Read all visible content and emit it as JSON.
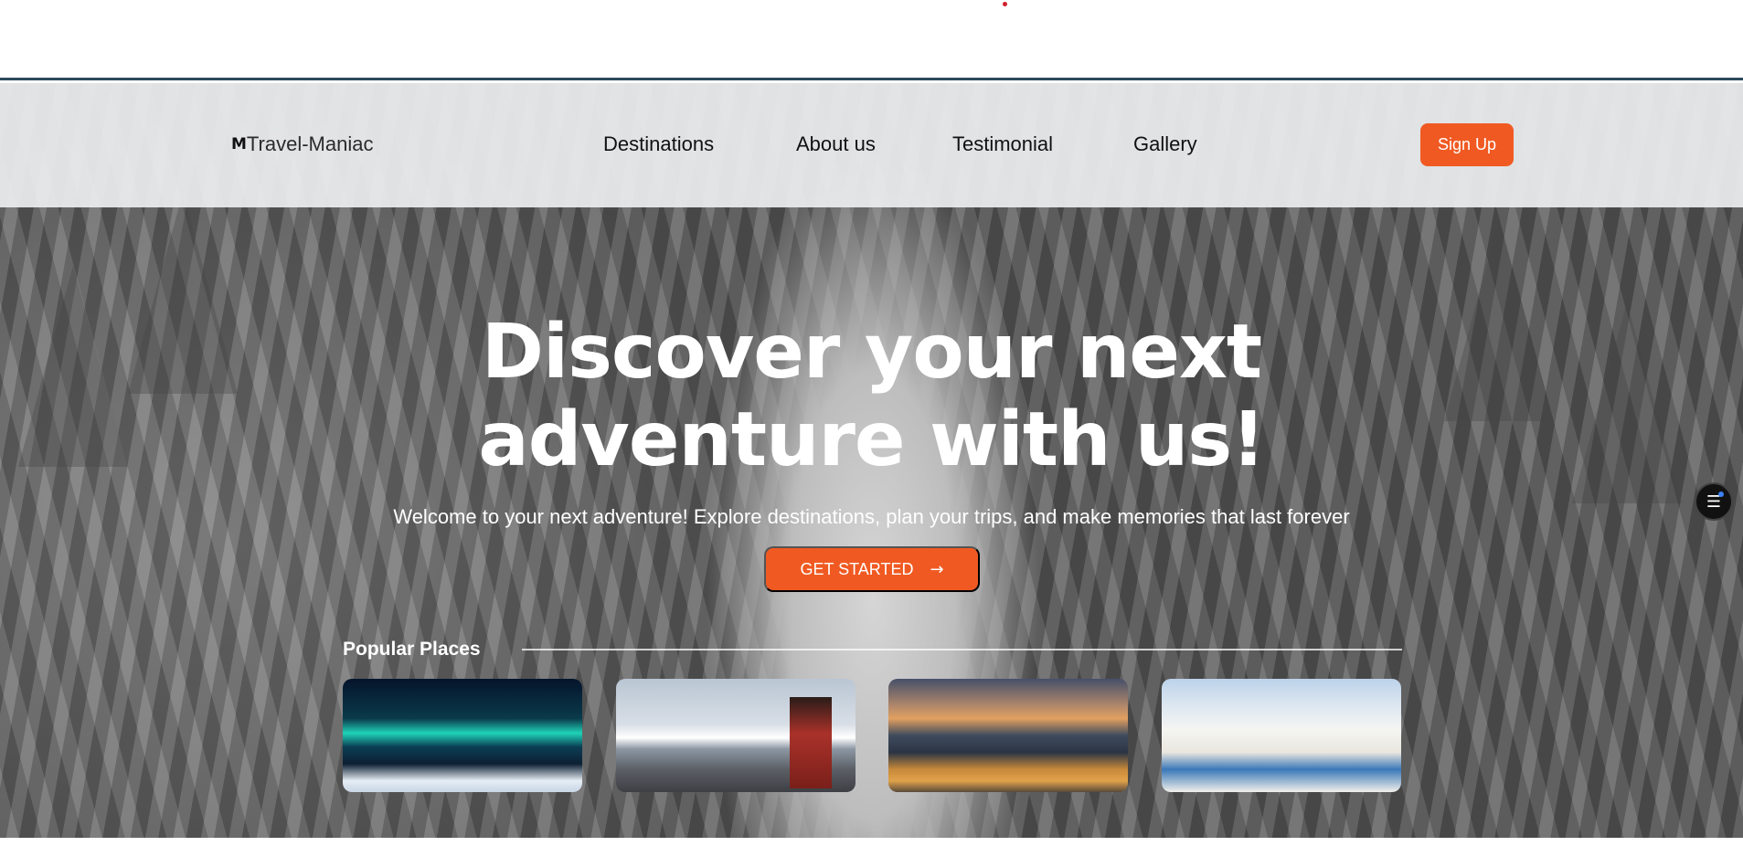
{
  "brand": {
    "logo_mark": "M",
    "name": "Travel-Maniac"
  },
  "nav": {
    "items": [
      "Destinations",
      "About us",
      "Testimonial",
      "Gallery"
    ],
    "signup_label": "Sign Up"
  },
  "hero": {
    "headline_line1": "Discover your next",
    "headline_line2": "adventure with us!",
    "subtitle": "Welcome to your next adventure! Explore destinations, plan your trips, and make memories that last forever",
    "cta_label": "GET STARTED",
    "cta_arrow": "→"
  },
  "popular": {
    "title": "Popular Places",
    "cards": [
      {
        "image": "aurora-cabin"
      },
      {
        "image": "mount-fuji-pagoda"
      },
      {
        "image": "coastal-city-harbor"
      },
      {
        "image": "santorini-village"
      }
    ]
  },
  "floating": {
    "icon": "menu-icon",
    "glyph": "☰"
  },
  "colors": {
    "accent": "#f05a22",
    "nav_bg": "#ecedef",
    "header_border": "#2e4a5e"
  }
}
